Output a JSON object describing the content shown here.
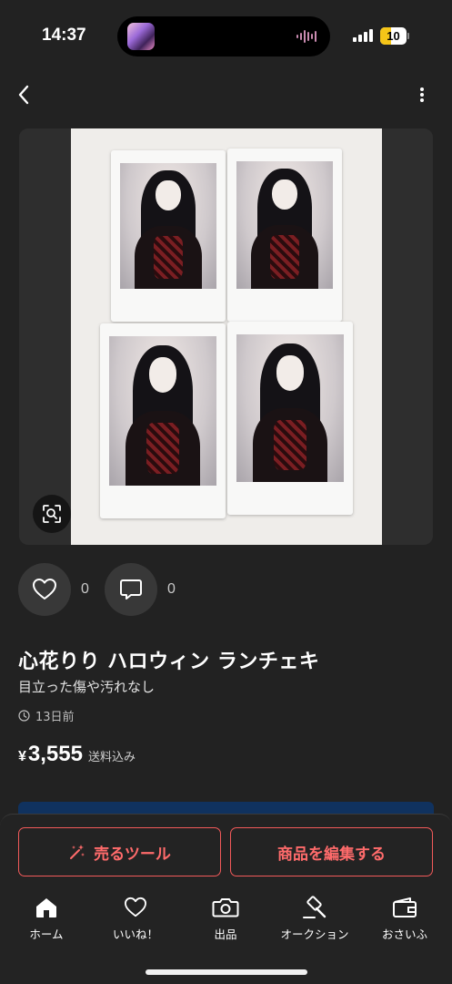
{
  "status_bar": {
    "time": "14:37",
    "battery_level": "10",
    "battery_fraction": 0.1,
    "icons": [
      "signal-icon",
      "battery-icon",
      "audio-wave-icon"
    ]
  },
  "nav": {
    "back_icon": "chevron-left-icon",
    "more_icon": "vertical-ellipsis-icon"
  },
  "image": {
    "description_icon": "image-search-icon",
    "photo_count": 4
  },
  "reactions": {
    "likes": "0",
    "comments": "0",
    "like_icon": "heart-icon",
    "comment_icon": "comment-icon"
  },
  "item": {
    "title": "心花りり ハロウィン ランチェキ",
    "condition": "目立った傷や汚れなし",
    "posted": "13日前",
    "price_symbol": "¥",
    "price": "3,555",
    "shipping": "送料込み"
  },
  "actions": {
    "sell_tool": "売るツール",
    "edit_item": "商品を編集する"
  },
  "tabs": [
    {
      "label": "ホーム",
      "icon": "home-icon"
    },
    {
      "label": "いいね！",
      "icon": "heart-icon"
    },
    {
      "label": "出品",
      "icon": "camera-icon"
    },
    {
      "label": "オークション",
      "icon": "gavel-icon"
    },
    {
      "label": "おさいふ",
      "icon": "wallet-icon"
    }
  ],
  "colors": {
    "background": "#222222",
    "accent_red": "#f25a5a",
    "strip_blue": "#10325f",
    "battery_yellow": "#f5c518"
  }
}
